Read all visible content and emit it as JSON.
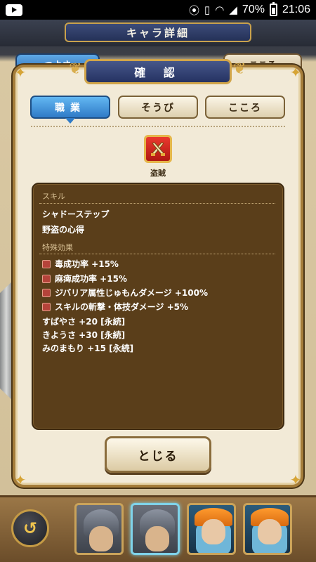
{
  "status_bar": {
    "battery_pct": "70%",
    "time": "21:06",
    "icons": [
      "youtube-icon",
      "location-icon",
      "vibrate-icon",
      "wifi-icon",
      "signal-icon",
      "battery-icon"
    ]
  },
  "header": {
    "title": "キャラ詳細"
  },
  "background_tabs": {
    "left": "つよさ",
    "right": "こころ"
  },
  "dialog": {
    "title": "確 認",
    "tabs": [
      {
        "label": "職業",
        "active": true
      },
      {
        "label": "そうび",
        "active": false
      },
      {
        "label": "こころ",
        "active": false
      }
    ],
    "job": {
      "name": "盗賊",
      "icon": "daggers-icon"
    },
    "skills": {
      "heading": "スキル",
      "items": [
        "シャドーステップ",
        "野盗の心得"
      ]
    },
    "special_effects": {
      "heading": "特殊効果",
      "items": [
        "毒成功率 +15%",
        "麻痺成功率 +15%",
        "ジバリア属性じゅもんダメージ +100%",
        "スキルの斬撃・体技ダメージ +5%"
      ],
      "permanent": [
        "すばやさ +20 [永続]",
        "きようさ +30 [永続]",
        "みのまもり +15 [永続]"
      ]
    },
    "close_label": "とじる"
  },
  "party": {
    "back_icon": "back-arrow-icon",
    "members": [
      {
        "kind": "knight",
        "selected": false
      },
      {
        "kind": "knight",
        "selected": true
      },
      {
        "kind": "mage",
        "selected": false
      },
      {
        "kind": "mage",
        "selected": false
      }
    ]
  },
  "colors": {
    "active_tab": "#2f7bc7",
    "panel": "#5a3e1a",
    "dialog_frame": "#a57d3a",
    "title_plate": "#253262"
  }
}
